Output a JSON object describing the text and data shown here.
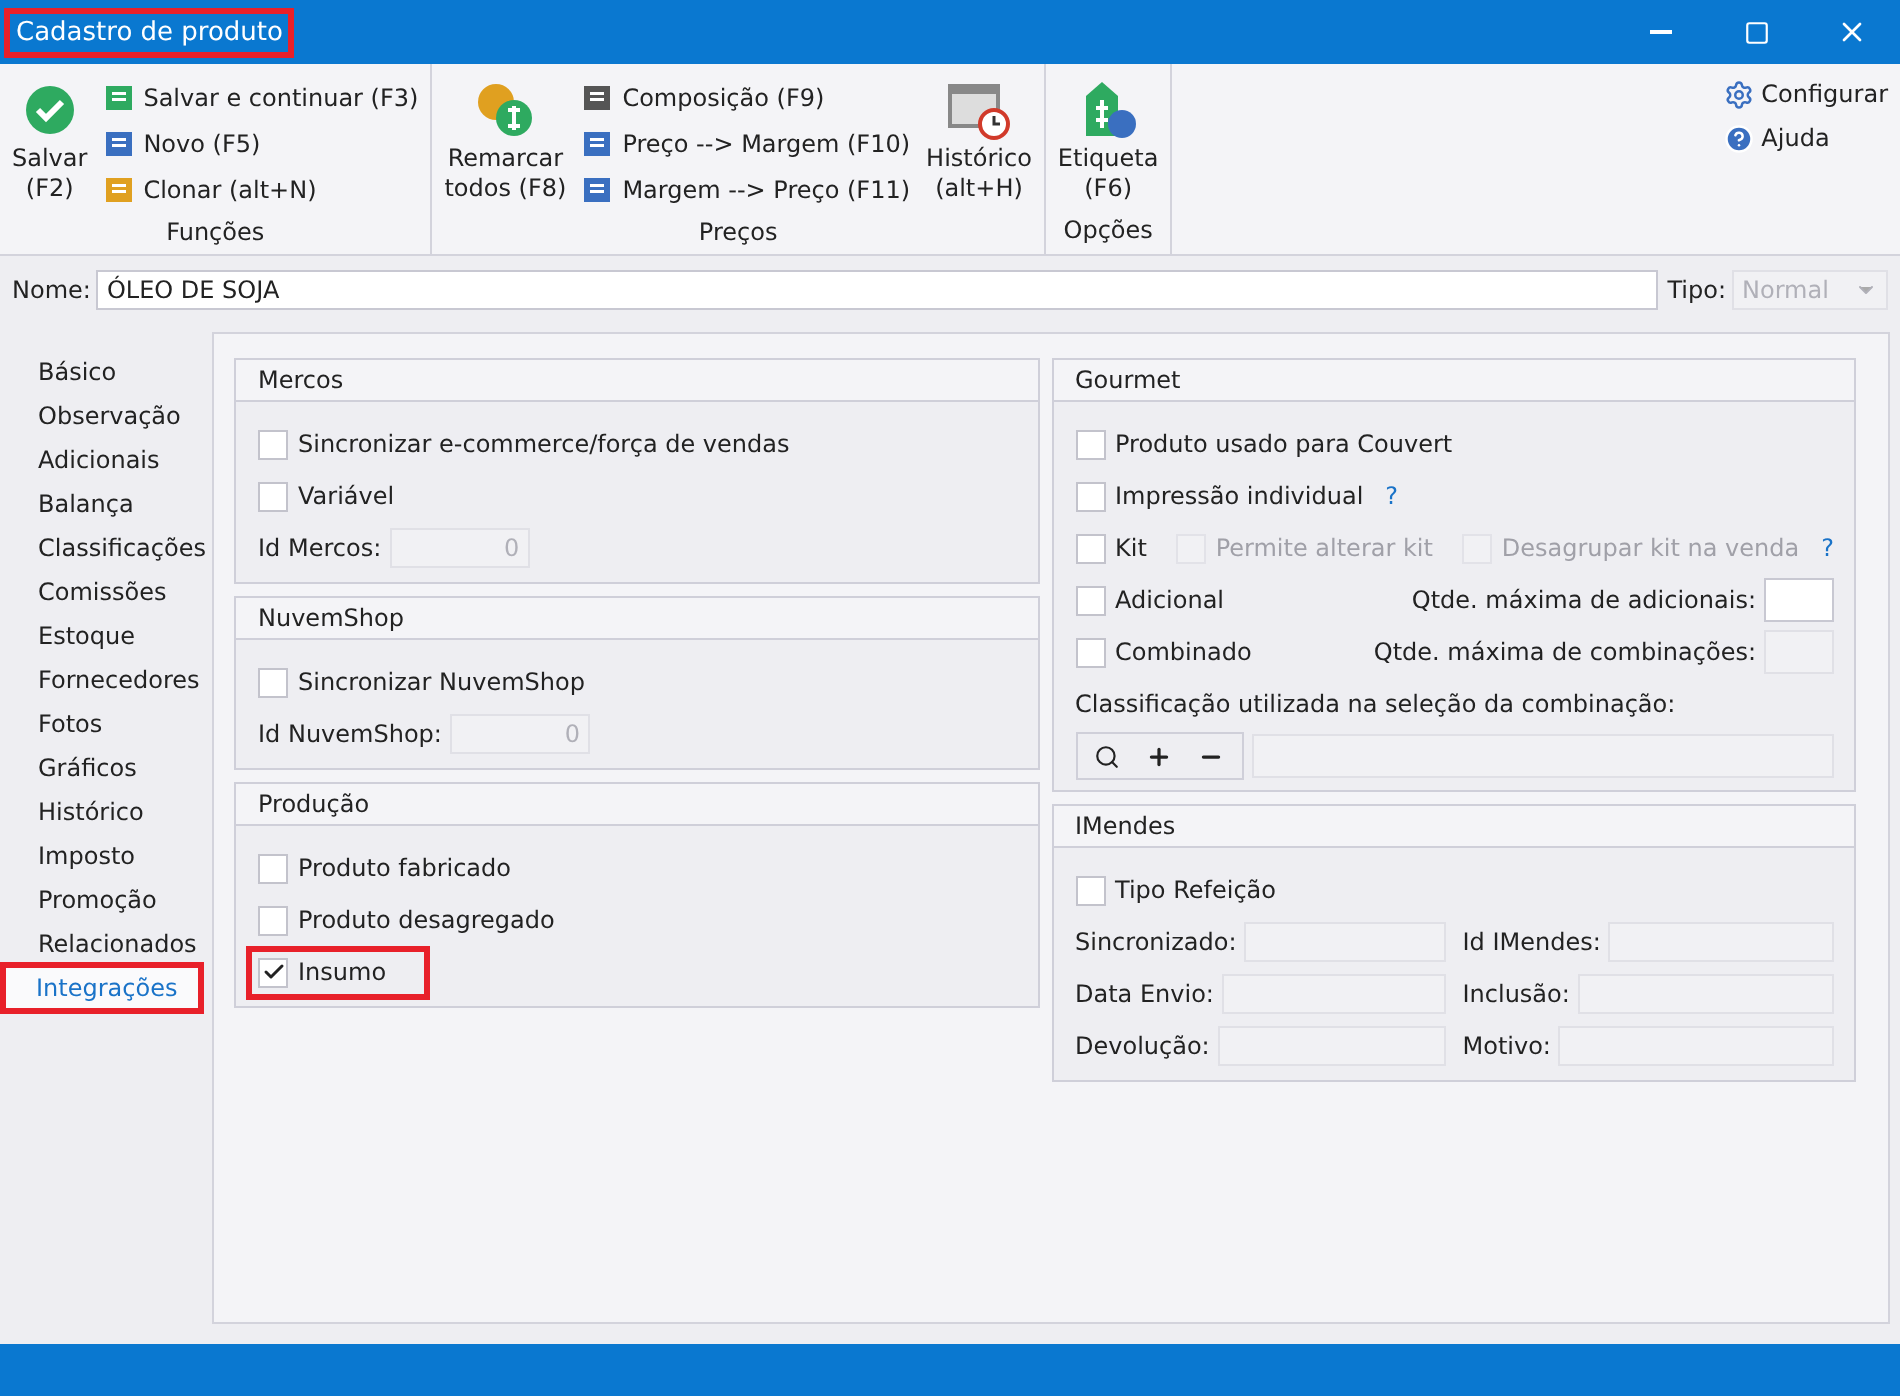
{
  "window": {
    "title": "Cadastro de produto",
    "title_highlighted": true
  },
  "ribbon": {
    "groups": [
      {
        "label": "Funções",
        "items": [
          {
            "kind": "big",
            "lines": [
              "Salvar",
              "(F2)"
            ]
          },
          {
            "kind": "small",
            "label": "Salvar e continuar (F3)"
          },
          {
            "kind": "small",
            "label": "Novo (F5)"
          },
          {
            "kind": "small",
            "label": "Clonar (alt+N)"
          }
        ]
      },
      {
        "label": "Preços",
        "items": [
          {
            "kind": "big",
            "lines": [
              "Remarcar",
              "todos (F8)"
            ]
          },
          {
            "kind": "small",
            "label": "Composição (F9)"
          },
          {
            "kind": "small",
            "label": "Preço --> Margem (F10)"
          },
          {
            "kind": "small",
            "label": "Margem --> Preço (F11)"
          },
          {
            "kind": "big",
            "lines": [
              "Histórico",
              "(alt+H)"
            ]
          }
        ]
      },
      {
        "label": "Opções",
        "items": [
          {
            "kind": "big",
            "lines": [
              "Etiqueta",
              "(F6)"
            ]
          }
        ]
      }
    ],
    "side": [
      {
        "label": "Configurar"
      },
      {
        "label": "Ajuda"
      }
    ]
  },
  "name_field": {
    "label": "Nome:",
    "value": "ÓLEO DE SOJA"
  },
  "type_field": {
    "label": "Tipo:",
    "value": "Normal",
    "disabled": true
  },
  "sidebar": {
    "items": [
      {
        "label": "Básico",
        "selected": false,
        "highlighted": false
      },
      {
        "label": "Observação",
        "selected": false,
        "highlighted": false
      },
      {
        "label": "Adicionais",
        "selected": false,
        "highlighted": false
      },
      {
        "label": "Balança",
        "selected": false,
        "highlighted": false
      },
      {
        "label": "Classificações",
        "selected": false,
        "highlighted": false
      },
      {
        "label": "Comissões",
        "selected": false,
        "highlighted": false
      },
      {
        "label": "Estoque",
        "selected": false,
        "highlighted": false
      },
      {
        "label": "Fornecedores",
        "selected": false,
        "highlighted": false
      },
      {
        "label": "Fotos",
        "selected": false,
        "highlighted": false
      },
      {
        "label": "Gráficos",
        "selected": false,
        "highlighted": false
      },
      {
        "label": "Histórico",
        "selected": false,
        "highlighted": false
      },
      {
        "label": "Imposto",
        "selected": false,
        "highlighted": false
      },
      {
        "label": "Promoção",
        "selected": false,
        "highlighted": false
      },
      {
        "label": "Relacionados",
        "selected": false,
        "highlighted": false
      },
      {
        "label": "Integrações",
        "selected": true,
        "highlighted": true
      }
    ]
  },
  "columns": [
    {
      "groups": [
        {
          "title": "Mercos",
          "rows": [
            {
              "cells": [
                {
                  "kind": "checkbox",
                  "label": "Sincronizar e-commerce/força de vendas",
                  "checked": false,
                  "disabled": false,
                  "highlighted": false
                }
              ]
            },
            {
              "cells": [
                {
                  "kind": "checkbox",
                  "label": "Variável",
                  "checked": false,
                  "disabled": false,
                  "highlighted": false
                }
              ]
            },
            {
              "cells": [
                {
                  "kind": "field",
                  "label": "Id Mercos:",
                  "value": "0",
                  "disabled": true
                }
              ]
            }
          ]
        },
        {
          "title": "NuvemShop",
          "rows": [
            {
              "cells": [
                {
                  "kind": "checkbox",
                  "label": "Sincronizar NuvemShop",
                  "checked": false,
                  "disabled": false,
                  "highlighted": false
                }
              ]
            },
            {
              "cells": [
                {
                  "kind": "field",
                  "label": "Id NuvemShop:",
                  "value": "0",
                  "disabled": true
                }
              ]
            }
          ]
        },
        {
          "title": "Produção",
          "rows": [
            {
              "cells": [
                {
                  "kind": "checkbox",
                  "label": "Produto fabricado",
                  "checked": false,
                  "disabled": false,
                  "highlighted": false
                }
              ]
            },
            {
              "cells": [
                {
                  "kind": "checkbox",
                  "label": "Produto desagregado",
                  "checked": false,
                  "disabled": false,
                  "highlighted": false
                }
              ]
            },
            {
              "cells": [
                {
                  "kind": "checkbox",
                  "label": "Insumo",
                  "checked": true,
                  "disabled": false,
                  "highlighted": true
                }
              ]
            }
          ]
        }
      ]
    },
    {
      "groups": [
        {
          "title": "Gourmet",
          "rows": [
            {
              "cells": [
                {
                  "kind": "checkbox",
                  "label": "Produto usado para Couvert",
                  "checked": false,
                  "disabled": false,
                  "highlighted": false
                }
              ]
            },
            {
              "cells": [
                {
                  "kind": "checkbox",
                  "label": "Impressão individual",
                  "checked": false,
                  "disabled": false,
                  "highlighted": false,
                  "help": "?"
                }
              ]
            },
            {
              "cells": [
                {
                  "kind": "checkbox",
                  "label": "Kit",
                  "checked": false,
                  "disabled": false,
                  "highlighted": false
                },
                {
                  "kind": "checkbox",
                  "label": "Permite alterar kit",
                  "checked": false,
                  "disabled": true,
                  "highlighted": false
                },
                {
                  "kind": "checkbox",
                  "label": "Desagrupar kit na venda",
                  "checked": false,
                  "disabled": true,
                  "highlighted": false,
                  "help": "?"
                }
              ]
            },
            {
              "cells": [
                {
                  "kind": "checkbox",
                  "label": "Adicional",
                  "checked": false,
                  "disabled": false,
                  "highlighted": false
                },
                {
                  "kind": "number",
                  "label": "Qtde. máxima de adicionais:",
                  "disabled": false
                }
              ]
            },
            {
              "cells": [
                {
                  "kind": "checkbox",
                  "label": "Combinado",
                  "checked": false,
                  "disabled": false,
                  "highlighted": false
                },
                {
                  "kind": "number",
                  "label": "Qtde. máxima de combinações:",
                  "disabled": true
                }
              ]
            },
            {
              "cells": [
                {
                  "kind": "caption",
                  "label": "Classificação utilizada na seleção da combinação:"
                }
              ]
            },
            {
              "cells": [
                {
                  "kind": "lookup"
                }
              ]
            }
          ]
        },
        {
          "title": "IMendes",
          "rows": [
            {
              "cells": [
                {
                  "kind": "checkbox",
                  "label": "Tipo Refeição",
                  "checked": false,
                  "disabled": false,
                  "highlighted": false
                }
              ]
            },
            {
              "cells": [
                {
                  "kind": "field",
                  "label": "Sincronizado:",
                  "disabled": true
                },
                {
                  "kind": "field",
                  "label": "Id IMendes:",
                  "disabled": true
                }
              ]
            },
            {
              "cells": [
                {
                  "kind": "field",
                  "label": "Data Envio:",
                  "disabled": true
                },
                {
                  "kind": "field",
                  "label": "Inclusão:",
                  "disabled": true
                }
              ]
            },
            {
              "cells": [
                {
                  "kind": "field",
                  "label": "Devolução:",
                  "disabled": true
                },
                {
                  "kind": "field",
                  "label": "Motivo:",
                  "disabled": true
                }
              ]
            }
          ]
        }
      ]
    }
  ]
}
